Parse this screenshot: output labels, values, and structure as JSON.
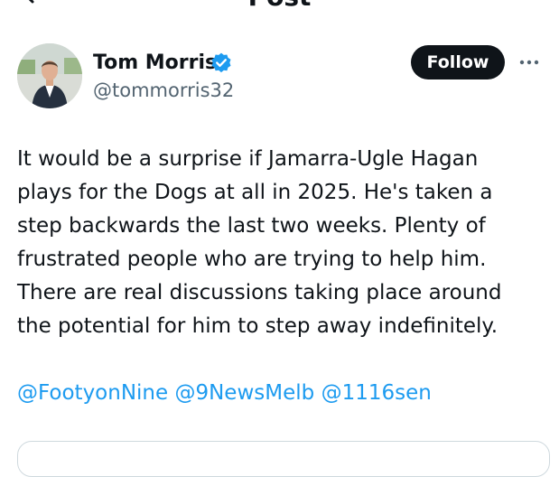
{
  "header": {
    "title": "Post"
  },
  "author": {
    "name": "Tom Morris",
    "handle": "@tommorris32",
    "verified": true
  },
  "follow_label": "Follow",
  "tweet": {
    "lines": [
      "It would be a surprise if Jamarra-Ugle Hagan",
      "plays for the Dogs at all in 2025. He's taken a",
      "step backwards the last two weeks. Plenty of",
      "frustrated people who are trying to help him.",
      "There are real discussions taking place around",
      "the potential for him to step away indefinitely."
    ],
    "mentions": [
      "@FootyonNine",
      "@9NewsMelb",
      "@1116sen"
    ]
  },
  "colors": {
    "text": "#0f1419",
    "secondary": "#536471",
    "link": "#1d9bf0",
    "verified": "#1d9bf0",
    "button_bg": "#0f1419",
    "button_text": "#ffffff"
  }
}
